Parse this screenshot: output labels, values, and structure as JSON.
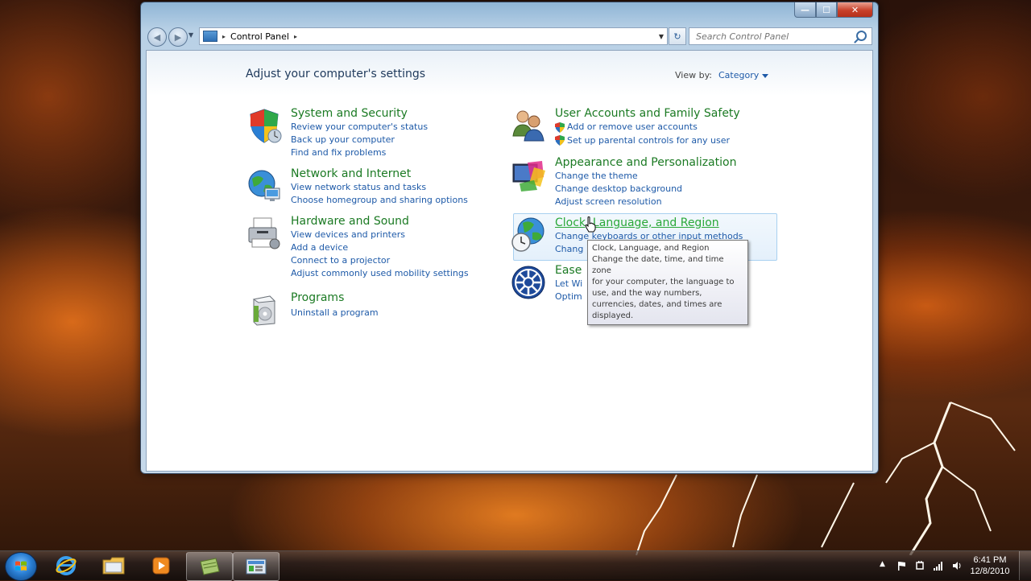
{
  "window": {
    "caption_buttons": {
      "minimize": "—",
      "maximize": "☐",
      "close": "✕"
    },
    "breadcrumb": {
      "root_arrow": "▸",
      "item": "Control Panel",
      "item_arrow": "▸"
    },
    "search": {
      "placeholder": "Search Control Panel"
    }
  },
  "page": {
    "title": "Adjust your computer's settings",
    "view_by_label": "View by:",
    "view_by_value": "Category"
  },
  "categories": {
    "system": {
      "title": "System and Security",
      "links": [
        "Review your computer's status",
        "Back up your computer",
        "Find and fix problems"
      ]
    },
    "network": {
      "title": "Network and Internet",
      "links": [
        "View network status and tasks",
        "Choose homegroup and sharing options"
      ]
    },
    "hardware": {
      "title": "Hardware and Sound",
      "links": [
        "View devices and printers",
        "Add a device",
        "Connect to a projector",
        "Adjust commonly used mobility settings"
      ]
    },
    "programs": {
      "title": "Programs",
      "links": [
        "Uninstall a program"
      ]
    },
    "users": {
      "title": "User Accounts and Family Safety",
      "links": [
        "Add or remove user accounts",
        "Set up parental controls for any user"
      ]
    },
    "appearance": {
      "title": "Appearance and Personalization",
      "links": [
        "Change the theme",
        "Change desktop background",
        "Adjust screen resolution"
      ]
    },
    "clock": {
      "title": "Clock, Language, and Region",
      "links": [
        "Change keyboards or other input methods",
        "Chang"
      ]
    },
    "ease": {
      "title": "Ease",
      "links": [
        "Let Wi",
        "Optim"
      ]
    }
  },
  "tooltip": {
    "lines": [
      "Clock, Language, and Region",
      "Change the date, time, and time zone",
      "for your computer, the language to",
      "use, and the way numbers,",
      "currencies, dates, and times are",
      "displayed."
    ]
  },
  "taskbar": {
    "time": "6:41 PM",
    "date": "12/8/2010",
    "tray_arrow": "▲"
  },
  "icons": {
    "nav_back": "◀",
    "nav_forward": "▶",
    "nav_dropdown": "▼",
    "address_dropdown": "▼",
    "refresh": "↻"
  }
}
